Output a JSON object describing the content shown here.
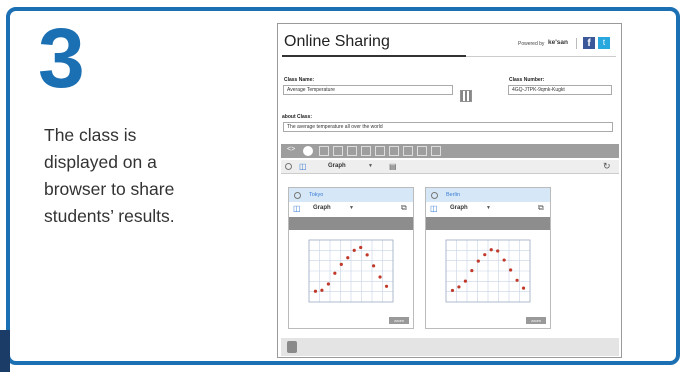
{
  "step": {
    "number": "3"
  },
  "description": {
    "lines": [
      "The class is",
      "displayed on a",
      "browser to share",
      "students’ results."
    ]
  },
  "app": {
    "title": "Online Sharing",
    "powered_by": "Powered by",
    "brand": "ke'san",
    "facebook_glyph": "f",
    "twitter_glyph": "t"
  },
  "form": {
    "class_name_label": "Class Name:",
    "class_name_value": "Average Temperature",
    "class_number_label": "Class Number:",
    "class_number_value": "4GQ-JTPK-9qmk-Kugkt",
    "about_label": "about Class:",
    "about_value": "The average temperature all over the world"
  },
  "toolbar": {
    "graph_select": "Graph"
  },
  "panels": [
    {
      "city": "Tokyo",
      "select": "Graph",
      "zoom": "zoom"
    },
    {
      "city": "Berlin",
      "select": "Graph",
      "zoom": "zoom"
    }
  ],
  "chart_data": [
    {
      "type": "scatter",
      "x": [
        1,
        2,
        3,
        4,
        5,
        6,
        7,
        8,
        9,
        10,
        11,
        12
      ],
      "values": [
        5.2,
        5.7,
        8.7,
        13.9,
        18.2,
        21.4,
        25.0,
        26.4,
        22.8,
        17.5,
        12.1,
        7.6
      ],
      "ylim": [
        0,
        30
      ],
      "xlim": [
        0,
        13
      ]
    },
    {
      "type": "scatter",
      "x": [
        1,
        2,
        3,
        4,
        5,
        6,
        7,
        8,
        9,
        10,
        11,
        12
      ],
      "values": [
        0.6,
        2.3,
        5.1,
        10.2,
        14.8,
        17.9,
        20.3,
        19.7,
        15.3,
        10.5,
        5.5,
        1.7
      ],
      "ylim": [
        -5,
        25
      ],
      "xlim": [
        0,
        13
      ]
    }
  ]
}
